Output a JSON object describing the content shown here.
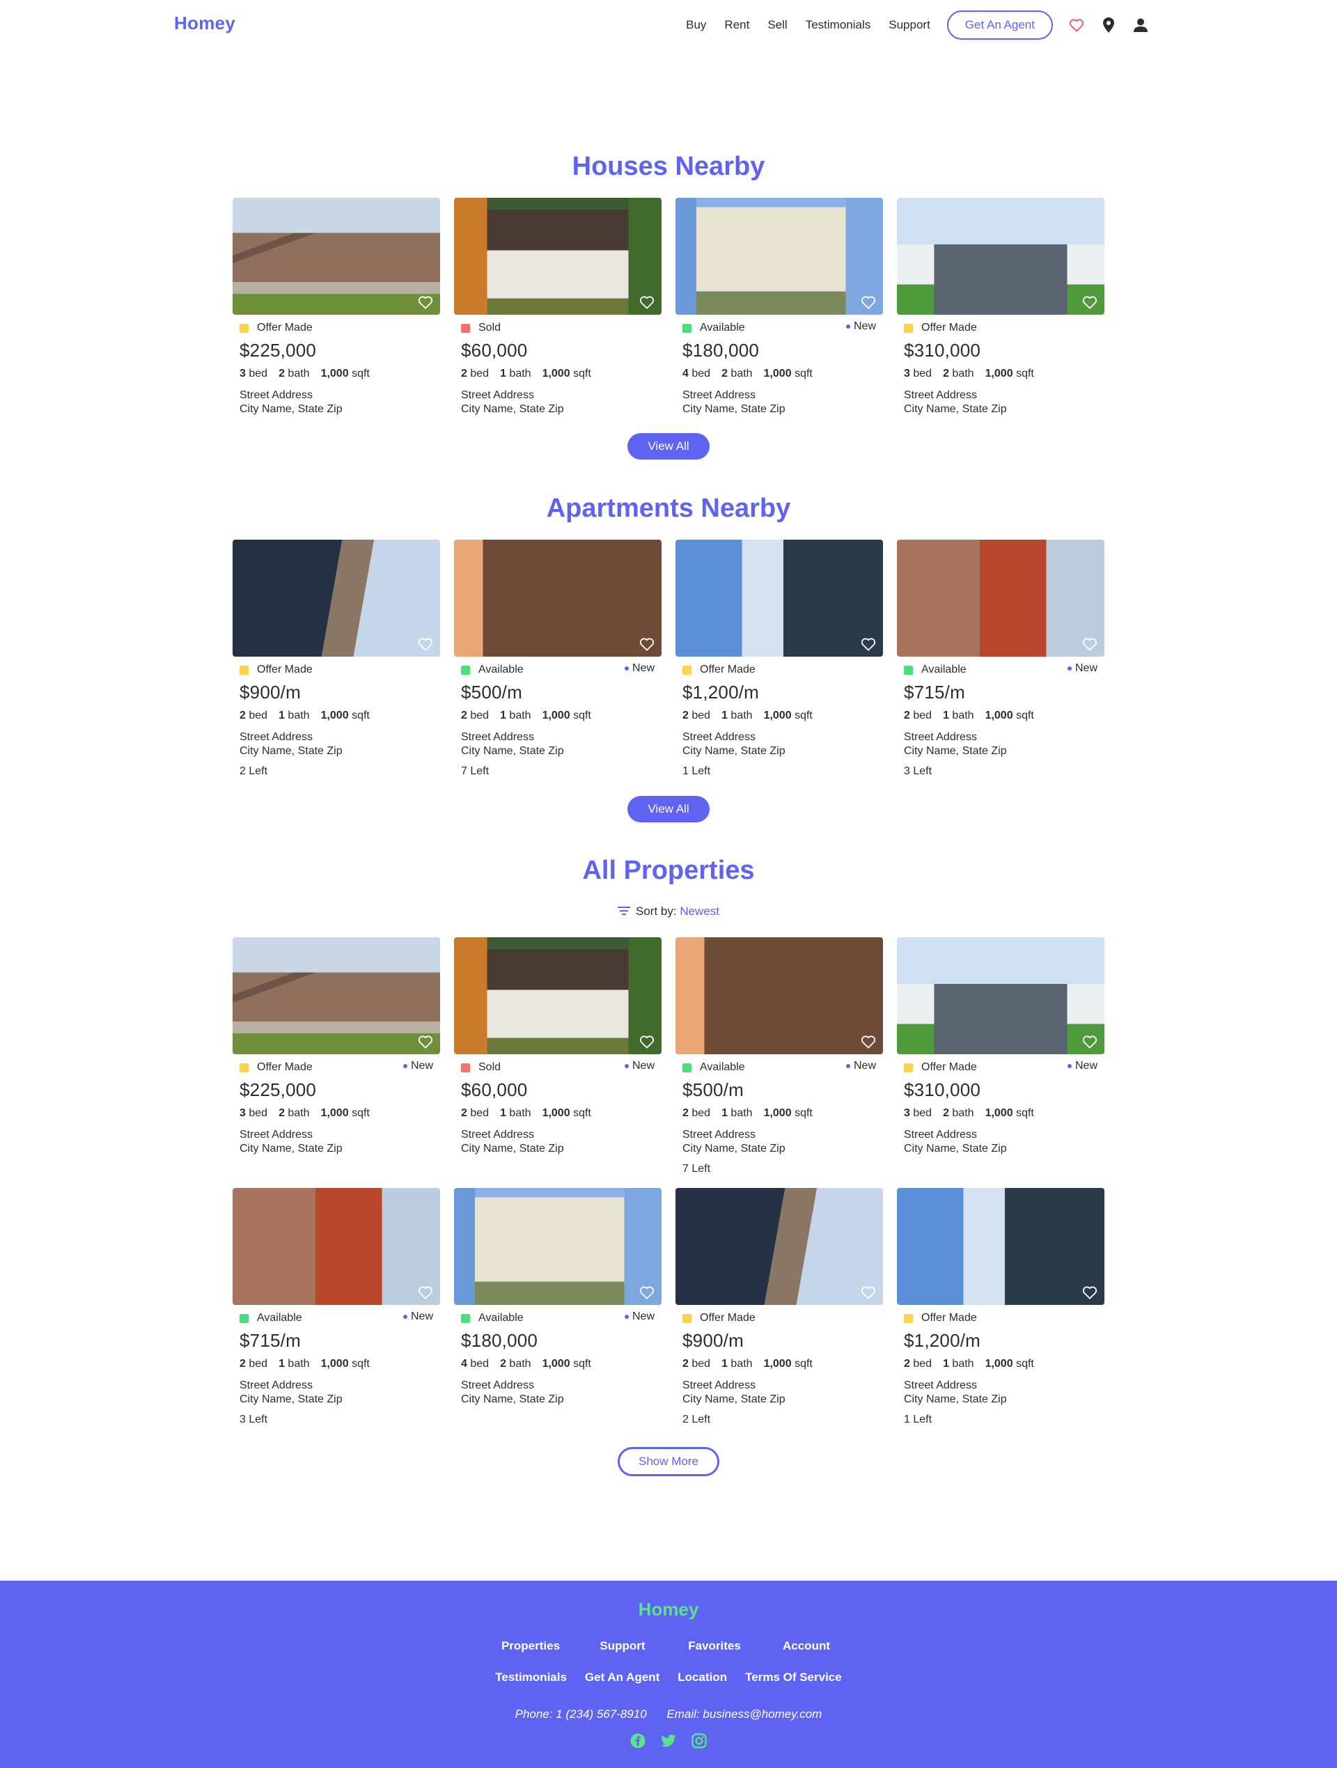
{
  "header": {
    "logo": "Homey",
    "nav": [
      "Buy",
      "Rent",
      "Sell",
      "Testimonials",
      "Support"
    ],
    "agent_button": "Get An Agent",
    "icons": [
      "heart-icon",
      "location-pin-icon",
      "user-icon"
    ]
  },
  "colors": {
    "brand": "#5f63f2",
    "offer_made": "#fcd34d",
    "sold": "#f87171",
    "available": "#4ade80",
    "footer_logo": "#59e48a"
  },
  "houses": {
    "title": "Houses Nearby",
    "view_all": "View All",
    "cards": [
      {
        "status": "Offer Made",
        "new": "",
        "price": "$225,000",
        "beds": "3",
        "baths": "2",
        "sqft": "1,000",
        "street": "Street Address",
        "city": "City Name, State Zip",
        "left": ""
      },
      {
        "status": "Sold",
        "new": "",
        "price": "$60,000",
        "beds": "2",
        "baths": "1",
        "sqft": "1,000",
        "street": "Street Address",
        "city": "City Name, State Zip",
        "left": ""
      },
      {
        "status": "Available",
        "new": "New",
        "price": "$180,000",
        "beds": "4",
        "baths": "2",
        "sqft": "1,000",
        "street": "Street Address",
        "city": "City Name, State Zip",
        "left": ""
      },
      {
        "status": "Offer Made",
        "new": "",
        "price": "$310,000",
        "beds": "3",
        "baths": "2",
        "sqft": "1,000",
        "street": "Street Address",
        "city": "City Name, State Zip",
        "left": ""
      }
    ]
  },
  "apartments": {
    "title": "Apartments Nearby",
    "view_all": "View All",
    "cards": [
      {
        "status": "Offer Made",
        "new": "",
        "price": "$900/m",
        "beds": "2",
        "baths": "1",
        "sqft": "1,000",
        "street": "Street Address",
        "city": "City Name, State Zip",
        "left": "2"
      },
      {
        "status": "Available",
        "new": "New",
        "price": "$500/m",
        "beds": "2",
        "baths": "1",
        "sqft": "1,000",
        "street": "Street Address",
        "city": "City Name, State Zip",
        "left": "7"
      },
      {
        "status": "Offer Made",
        "new": "",
        "price": "$1,200/m",
        "beds": "2",
        "baths": "1",
        "sqft": "1,000",
        "street": "Street Address",
        "city": "City Name, State Zip",
        "left": "1"
      },
      {
        "status": "Available",
        "new": "New",
        "price": "$715/m",
        "beds": "2",
        "baths": "1",
        "sqft": "1,000",
        "street": "Street Address",
        "city": "City Name, State Zip",
        "left": "3"
      }
    ]
  },
  "all": {
    "title": "All Properties",
    "sort_label": "Sort by:",
    "sort_value": "Newest",
    "show_more": "Show More",
    "cards": [
      {
        "status": "Offer Made",
        "new": "New",
        "price": "$225,000",
        "beds": "3",
        "baths": "2",
        "sqft": "1,000",
        "street": "Street Address",
        "city": "City Name, State Zip",
        "left": ""
      },
      {
        "status": "Sold",
        "new": "New",
        "price": "$60,000",
        "beds": "2",
        "baths": "1",
        "sqft": "1,000",
        "street": "Street Address",
        "city": "City Name, State Zip",
        "left": ""
      },
      {
        "status": "Available",
        "new": "New",
        "price": "$500/m",
        "beds": "2",
        "baths": "1",
        "sqft": "1,000",
        "street": "Street Address",
        "city": "City Name, State Zip",
        "left": "7"
      },
      {
        "status": "Offer Made",
        "new": "New",
        "price": "$310,000",
        "beds": "3",
        "baths": "2",
        "sqft": "1,000",
        "street": "Street Address",
        "city": "City Name, State Zip",
        "left": ""
      },
      {
        "status": "Available",
        "new": "New",
        "price": "$715/m",
        "beds": "2",
        "baths": "1",
        "sqft": "1,000",
        "street": "Street Address",
        "city": "City Name, State Zip",
        "left": "3"
      },
      {
        "status": "Available",
        "new": "New",
        "price": "$180,000",
        "beds": "4",
        "baths": "2",
        "sqft": "1,000",
        "street": "Street Address",
        "city": "City Name, State Zip",
        "left": ""
      },
      {
        "status": "Offer Made",
        "new": "",
        "price": "$900/m",
        "beds": "2",
        "baths": "1",
        "sqft": "1,000",
        "street": "Street Address",
        "city": "City Name, State Zip",
        "left": "2"
      },
      {
        "status": "Offer Made",
        "new": "",
        "price": "$1,200/m",
        "beds": "2",
        "baths": "1",
        "sqft": "1,000",
        "street": "Street Address",
        "city": "City Name, State Zip",
        "left": "1"
      }
    ]
  },
  "labels": {
    "bed": "bed",
    "bath": "bath",
    "sqft": "sqft",
    "left": "Left"
  },
  "footer": {
    "logo": "Homey",
    "row1": [
      "Properties",
      "Support",
      "Favorites",
      "Account"
    ],
    "row2": [
      "Testimonials",
      "Get An Agent",
      "Location",
      "Terms Of Service"
    ],
    "phone": "Phone: 1 (234) 567-8910",
    "email": "Email: business@homey.com",
    "socials": [
      "facebook-icon",
      "twitter-icon",
      "instagram-icon"
    ]
  }
}
